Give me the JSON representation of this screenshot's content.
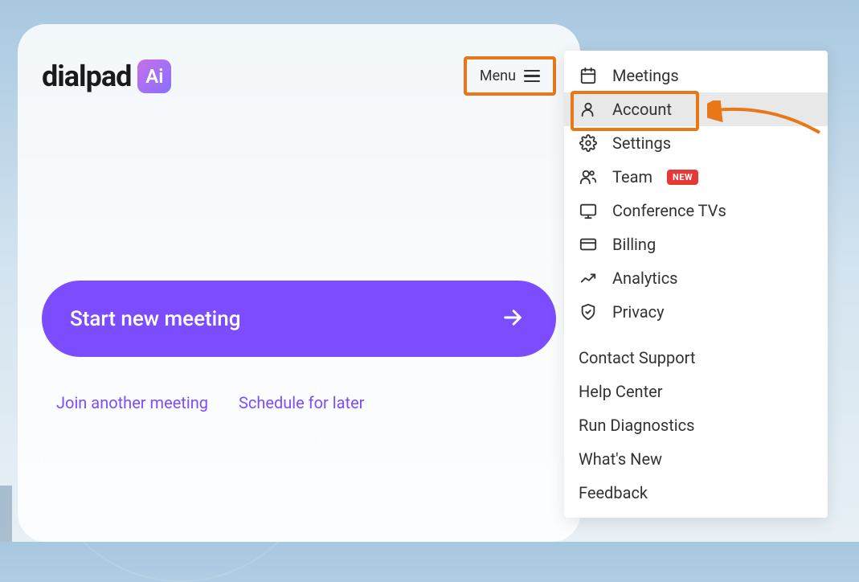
{
  "brand": {
    "name": "dialpad",
    "icon_glyph": "Ai"
  },
  "header": {
    "menu_label": "Menu"
  },
  "main": {
    "start_button": "Start new meeting",
    "join_link": "Join another meeting",
    "schedule_link": "Schedule for later"
  },
  "dropdown": {
    "primary": [
      {
        "icon": "calendar",
        "label": "Meetings"
      },
      {
        "icon": "user",
        "label": "Account",
        "highlighted": true
      },
      {
        "icon": "gear",
        "label": "Settings"
      },
      {
        "icon": "team",
        "label": "Team",
        "badge": "NEW"
      },
      {
        "icon": "monitor",
        "label": "Conference TVs"
      },
      {
        "icon": "card",
        "label": "Billing"
      },
      {
        "icon": "chart",
        "label": "Analytics"
      },
      {
        "icon": "shield",
        "label": "Privacy"
      }
    ],
    "secondary": [
      {
        "label": "Contact Support"
      },
      {
        "label": "Help Center"
      },
      {
        "label": "Run Diagnostics"
      },
      {
        "label": "What's New"
      },
      {
        "label": "Feedback"
      }
    ]
  },
  "colors": {
    "accent_purple": "#7c4dff",
    "annotation_orange": "#e87817",
    "badge_red": "#e53935"
  }
}
